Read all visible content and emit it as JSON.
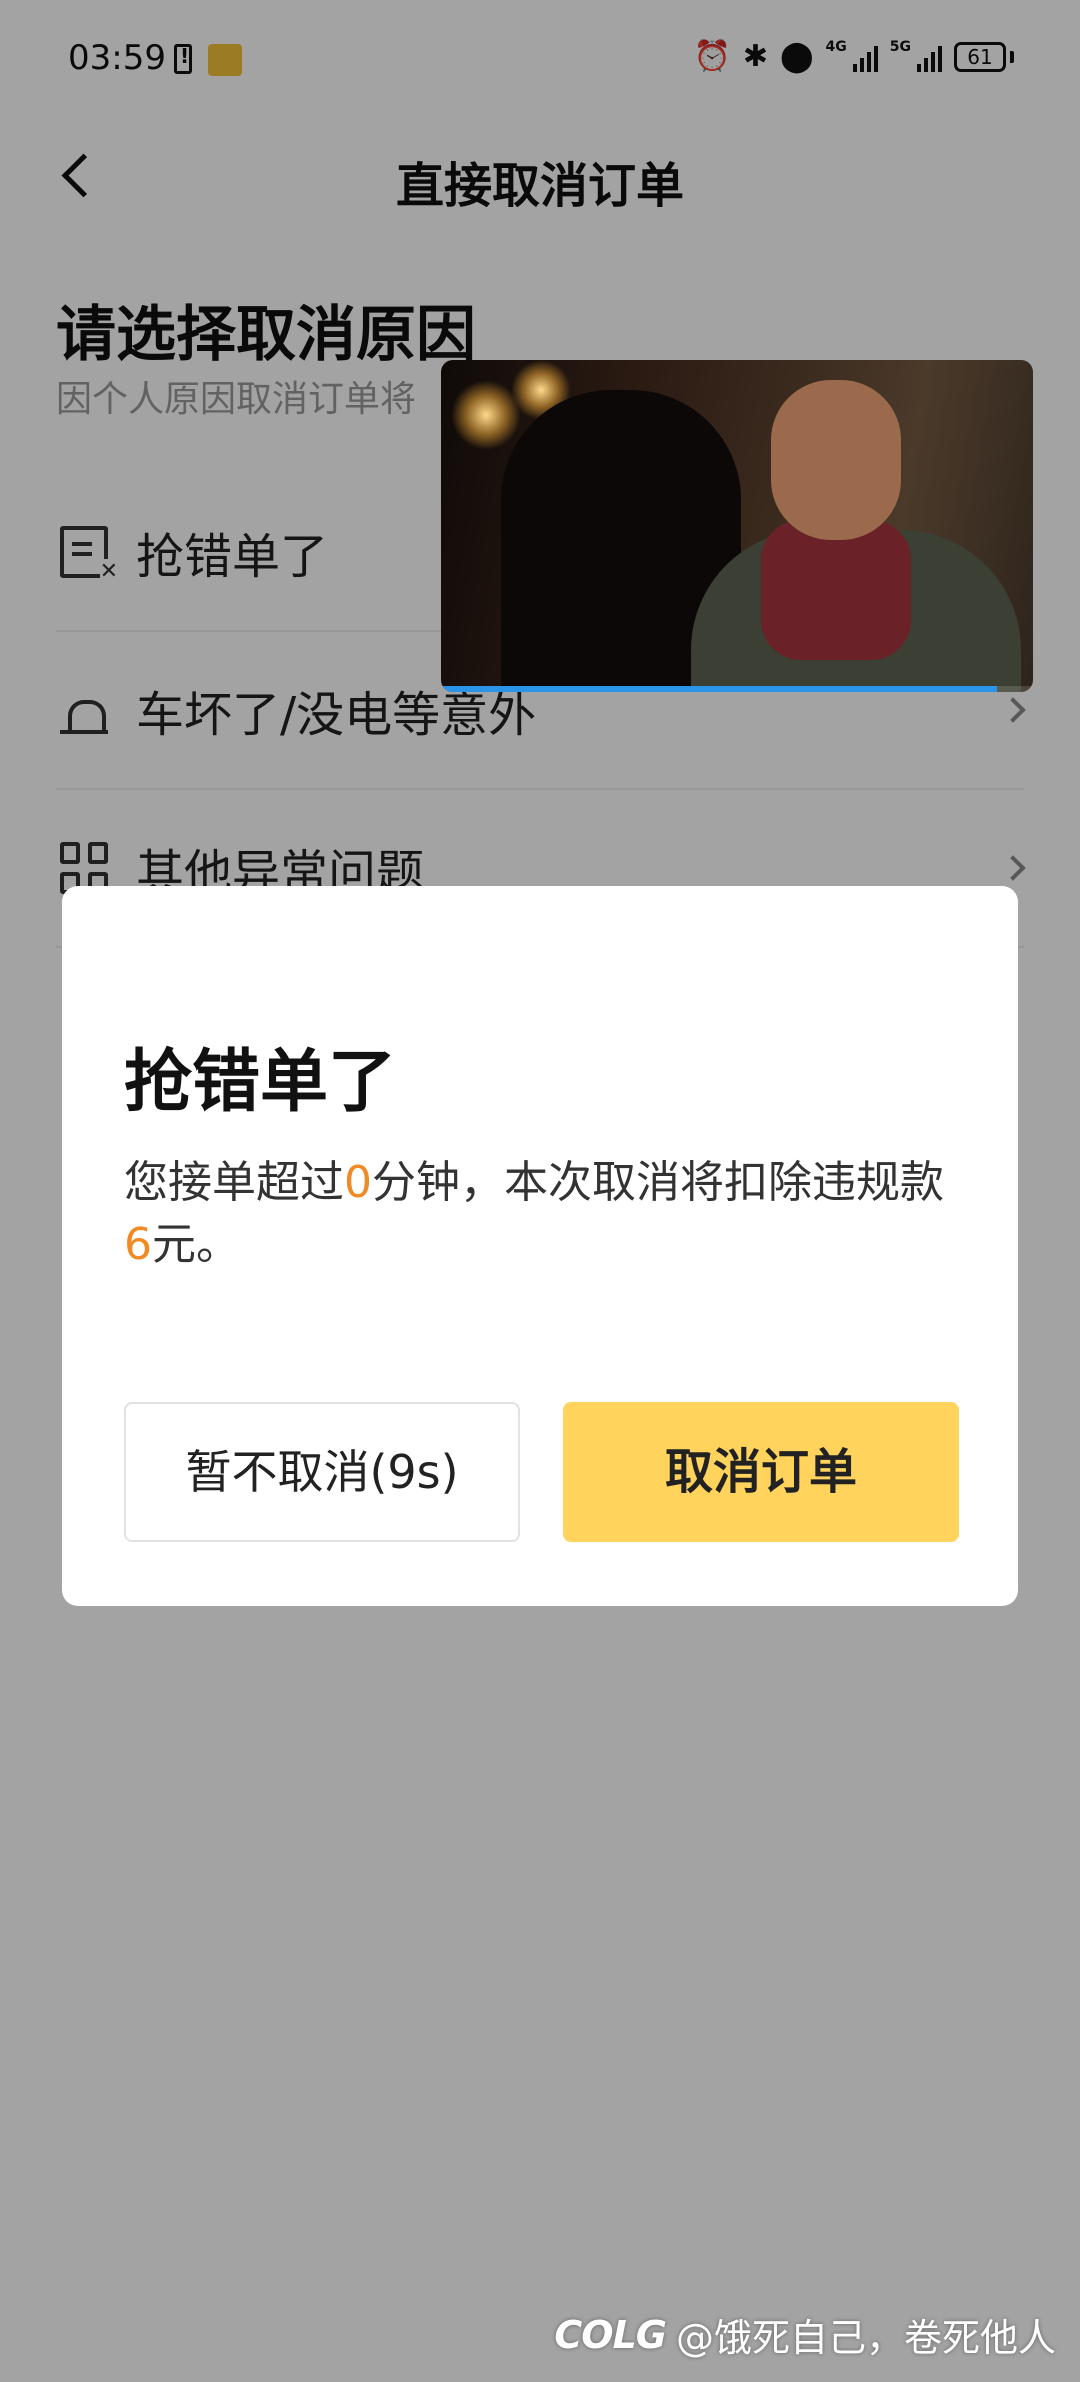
{
  "status_bar": {
    "time": "03:59",
    "network_1": "4G",
    "network_2": "5G",
    "battery": "61",
    "icons": [
      "battery-alert-icon",
      "app-notification-icon",
      "alarm-icon",
      "bluetooth-icon",
      "location-icon",
      "signal-icon",
      "battery-icon"
    ]
  },
  "header": {
    "back_icon": "chevron-left-icon",
    "title": "直接取消订单"
  },
  "reasons": {
    "heading": "请选择取消原因",
    "subtitle": "因个人原因取消订单将",
    "items": [
      {
        "label": "抢错单了",
        "icon": "document-x-icon"
      },
      {
        "label": "车坏了/没电等意外",
        "icon": "alarm-light-icon"
      },
      {
        "label": "其他异常问题",
        "icon": "grid-icon"
      }
    ]
  },
  "video": {
    "progress": 0.94,
    "accent": "#2a94e8"
  },
  "dialog": {
    "title": "抢错单了",
    "message_part1": "您接单超过",
    "minutes": "0",
    "message_part2": "分钟，本次取消将扣除违规款",
    "amount": "6",
    "message_part3": "元。",
    "keep_button": "暂不取消(9s)",
    "cancel_button": "取消订单",
    "highlight_color": "#f08a24",
    "cancel_button_color": "#ffd35c"
  },
  "watermark": {
    "logo": "COLG",
    "text": "@饿死自己，卷死他人"
  }
}
